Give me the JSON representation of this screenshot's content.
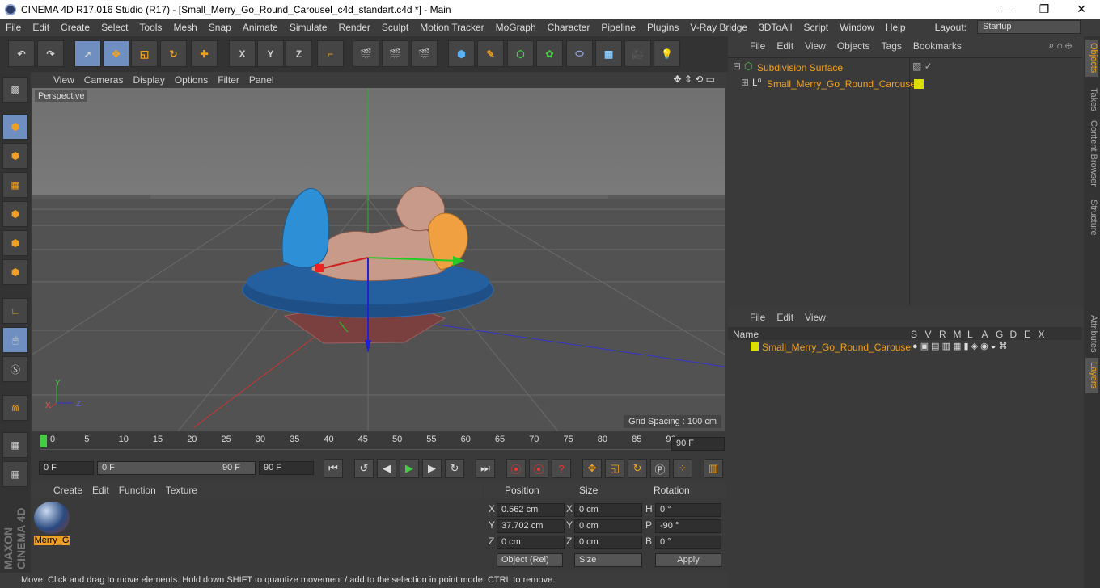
{
  "window": {
    "title": "CINEMA 4D R17.016 Studio (R17) - [Small_Merry_Go_Round_Carousel_c4d_standart.c4d *] - Main",
    "min": "—",
    "max": "❐",
    "close": "✕"
  },
  "menu": [
    "File",
    "Edit",
    "Create",
    "Select",
    "Tools",
    "Mesh",
    "Snap",
    "Animate",
    "Simulate",
    "Render",
    "Sculpt",
    "Motion Tracker",
    "MoGraph",
    "Character",
    "Pipeline",
    "Plugins",
    "V-Ray Bridge",
    "3DToAll",
    "Script",
    "Window",
    "Help"
  ],
  "layout": {
    "label": "Layout:",
    "value": "Startup"
  },
  "toolbar": {
    "x": "X",
    "y": "Y",
    "z": "Z"
  },
  "viewport": {
    "menu": [
      "View",
      "Cameras",
      "Display",
      "Options",
      "Filter",
      "Panel"
    ],
    "label": "Perspective",
    "grid": "Grid Spacing : 100 cm",
    "axes": {
      "x": "X",
      "y": "Y",
      "z": "Z"
    }
  },
  "timeline": {
    "ticks": [
      "0",
      "5",
      "10",
      "15",
      "20",
      "25",
      "30",
      "35",
      "40",
      "45",
      "50",
      "55",
      "60",
      "65",
      "70",
      "75",
      "80",
      "85",
      "90"
    ],
    "end": "90 F"
  },
  "transport": {
    "start": "0 F",
    "cur": "0 F",
    "range_end": "90 F",
    "end": "90 F",
    "min": "0 F"
  },
  "material": {
    "menu": [
      "Create",
      "Edit",
      "Function",
      "Texture"
    ],
    "name": "Merry_G"
  },
  "coords": {
    "headers": [
      "Position",
      "Size",
      "Rotation"
    ],
    "rows": [
      {
        "a": "X",
        "pos": "0.562 cm",
        "b": "X",
        "size": "0 cm",
        "c": "H",
        "rot": "0 °"
      },
      {
        "a": "Y",
        "pos": "37.702 cm",
        "b": "Y",
        "size": "0 cm",
        "c": "P",
        "rot": "-90 °"
      },
      {
        "a": "Z",
        "pos": "0 cm",
        "b": "Z",
        "size": "0 cm",
        "c": "B",
        "rot": "0 °"
      }
    ],
    "mode": "Object (Rel)",
    "size_mode": "Size",
    "apply": "Apply"
  },
  "objects": {
    "menu": [
      "File",
      "Edit",
      "View",
      "Objects",
      "Tags",
      "Bookmarks"
    ],
    "items": [
      "Subdivision Surface",
      "Small_Merry_Go_Round_Carousel"
    ]
  },
  "layers": {
    "menu": [
      "File",
      "Edit",
      "View"
    ],
    "cols": [
      "Name",
      "S",
      "V",
      "R",
      "M",
      "L",
      "A",
      "G",
      "D",
      "E",
      "X"
    ],
    "item": "Small_Merry_Go_Round_Carousel"
  },
  "tabs": [
    "Objects",
    "Takes",
    "Content Browser",
    "Structure",
    "Attributes",
    "Layers"
  ],
  "brand": "MAXON CINEMA 4D",
  "status": "Move: Click and drag to move elements. Hold down SHIFT to quantize movement / add to the selection in point mode, CTRL to remove."
}
